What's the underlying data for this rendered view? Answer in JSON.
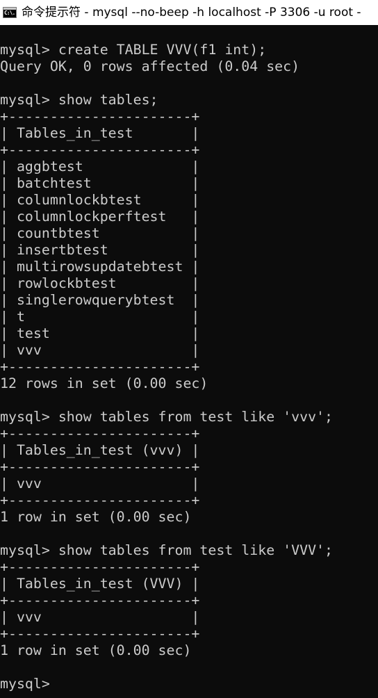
{
  "window": {
    "title": "命令提示符 - mysql  --no-beep -h localhost -P 3306 -u root -",
    "icon_text": "C:\\."
  },
  "console": {
    "lines": [
      "mysql> create TABLE VVV(f1 int);",
      "Query OK, 0 rows affected (0.04 sec)",
      "",
      "mysql> show tables;",
      "+----------------------+",
      "| Tables_in_test       |",
      "+----------------------+",
      "| aggbtest             |",
      "| batchtest            |",
      "| columnlockbtest      |",
      "| columnlockperftest   |",
      "| countbtest           |",
      "| insertbtest          |",
      "| multirowsupdatebtest |",
      "| rowlockbtest         |",
      "| singlerowquerybtest  |",
      "| t                    |",
      "| test                 |",
      "| vvv                  |",
      "+----------------------+",
      "12 rows in set (0.00 sec)",
      "",
      "mysql> show tables from test like 'vvv';",
      "+----------------------+",
      "| Tables_in_test (vvv) |",
      "+----------------------+",
      "| vvv                  |",
      "+----------------------+",
      "1 row in set (0.00 sec)",
      "",
      "mysql> show tables from test like 'VVV';",
      "+----------------------+",
      "| Tables_in_test (VVV) |",
      "+----------------------+",
      "| vvv                  |",
      "+----------------------+",
      "1 row in set (0.00 sec)",
      "",
      "mysql> "
    ]
  }
}
